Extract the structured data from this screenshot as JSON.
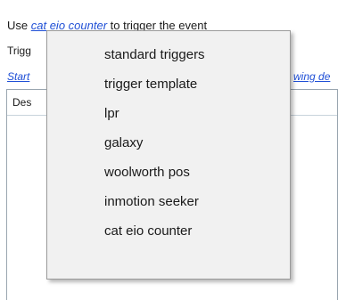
{
  "intro": {
    "prefix": "Use",
    "link": "cat eio counter",
    "suffix": "to trigger the event"
  },
  "trigger_label": "Trigg",
  "start_link_partial": "Start",
  "right_link_partial": "wing de",
  "list": {
    "header_partial": "Des"
  },
  "menu": {
    "items": [
      {
        "label": "standard triggers"
      },
      {
        "label": "trigger template"
      },
      {
        "label": "lpr"
      },
      {
        "label": "galaxy"
      },
      {
        "label": "woolworth pos"
      },
      {
        "label": "inmotion seeker"
      },
      {
        "label": "cat eio counter"
      }
    ]
  }
}
